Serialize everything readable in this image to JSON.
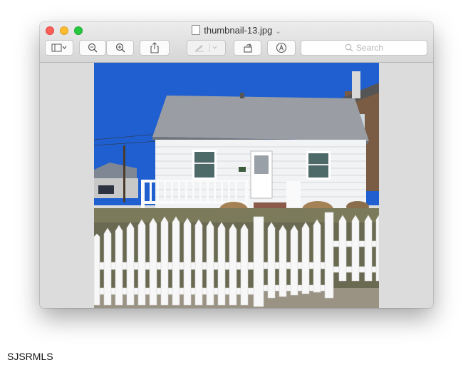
{
  "window": {
    "title": "thumbnail-13.jpg",
    "title_chevron": "⌄",
    "toolbar": {
      "sidebar_icon": "sidebar-icon",
      "zoom_out_icon": "zoom-out-icon",
      "zoom_in_icon": "zoom-in-icon",
      "share_icon": "share-icon",
      "markup_icon": "markup-pen-icon",
      "rotate_icon": "rotate-icon",
      "annotate_icon": "annotate-icon",
      "search_placeholder": "Search"
    }
  },
  "image": {
    "description_icon": "house-photo"
  },
  "caption": "SJSRMLS",
  "colors": {
    "close": "#fc5f57",
    "minimize": "#fdbc2e",
    "maximize": "#28c840",
    "sky": "#1f5fcf"
  }
}
